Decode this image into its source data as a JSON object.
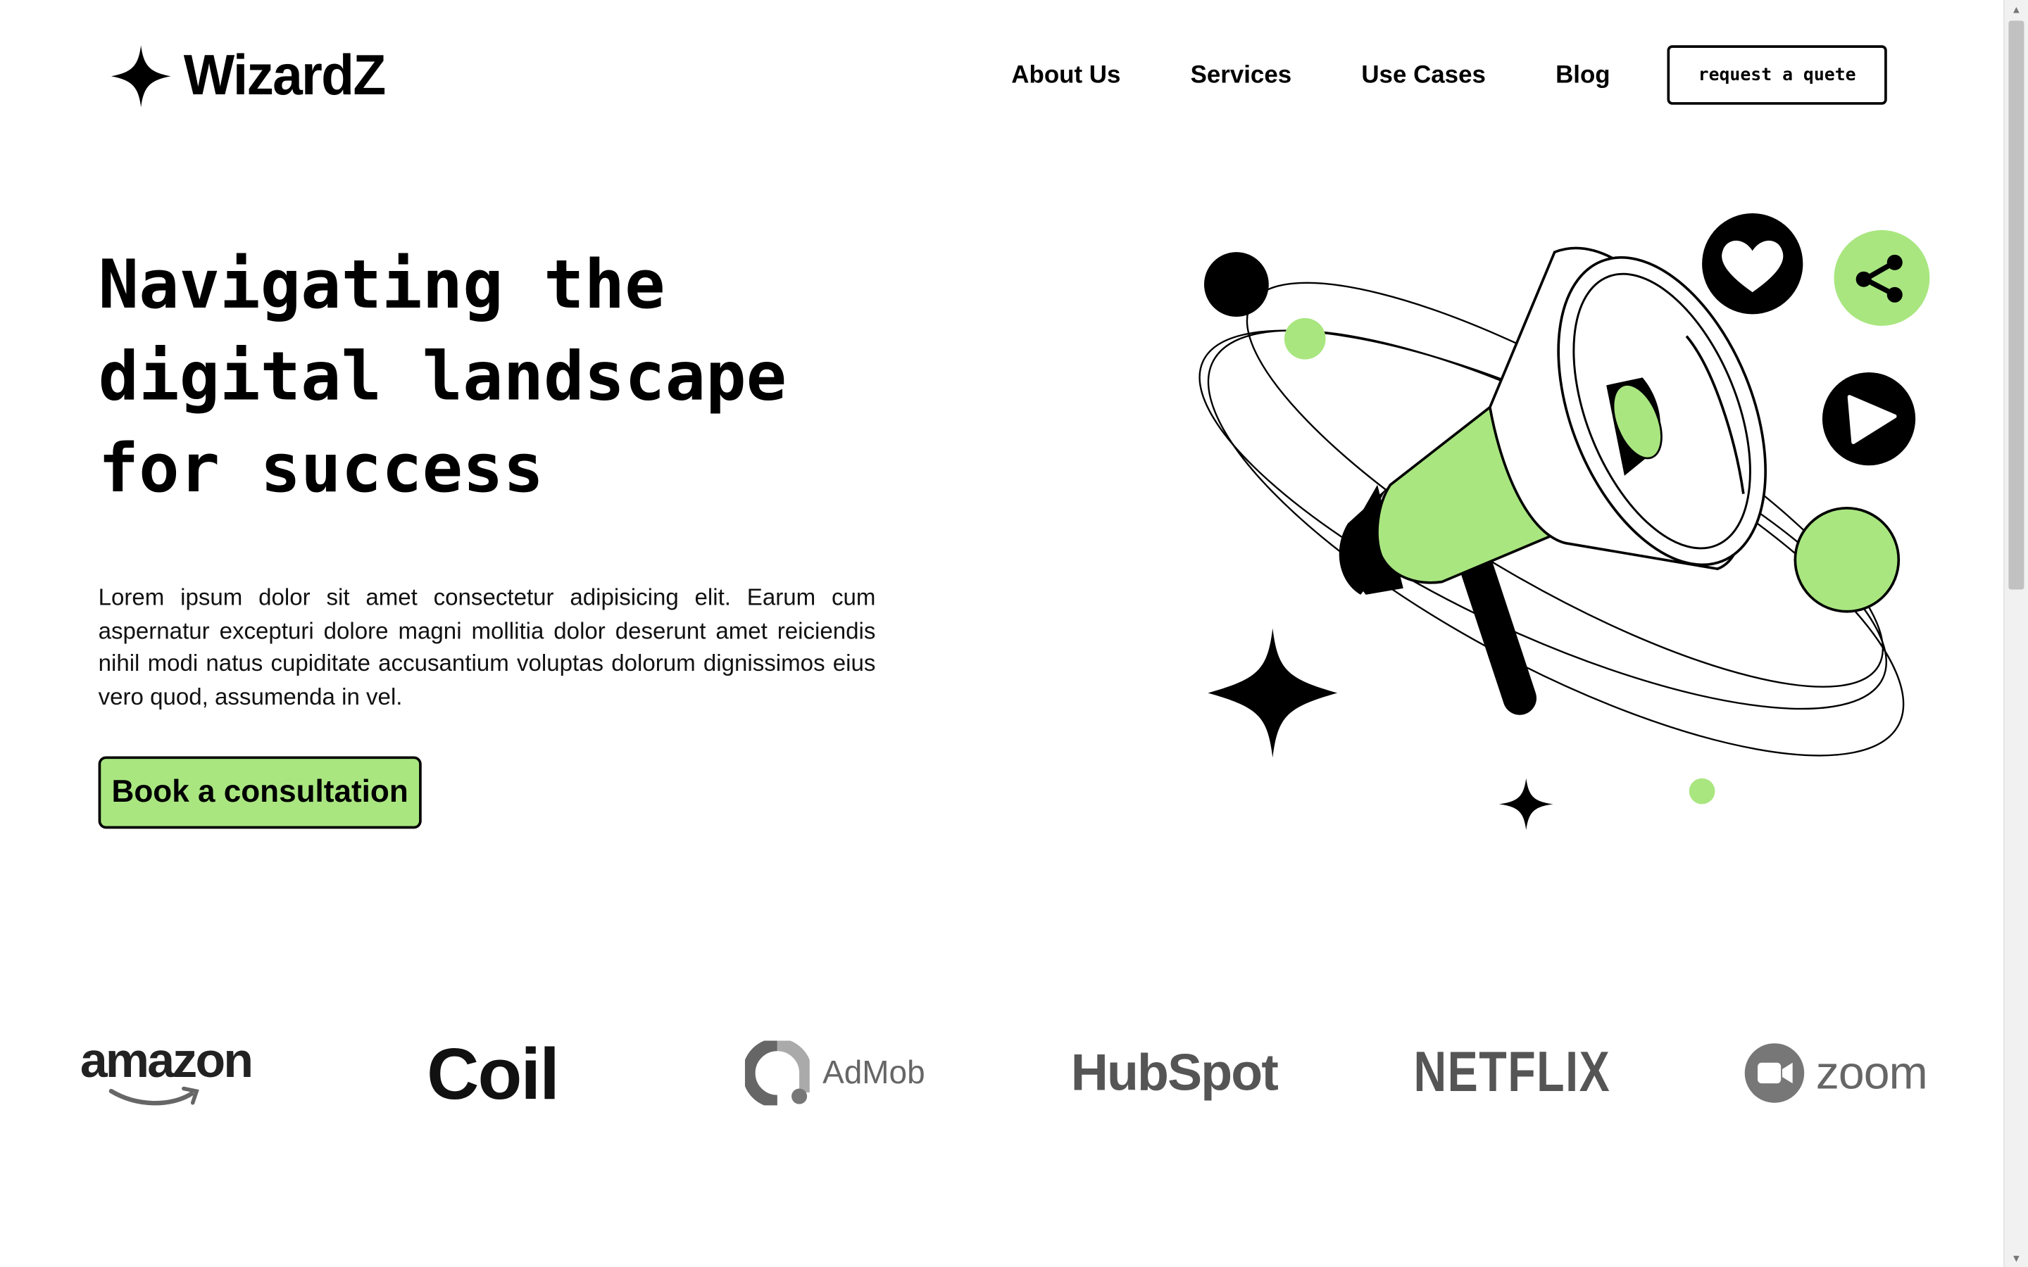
{
  "brand": {
    "name": "WizardZ",
    "logo_icon": "sparkle-star-icon"
  },
  "nav": {
    "items": [
      {
        "label": "About Us"
      },
      {
        "label": "Services"
      },
      {
        "label": "Use Cases"
      },
      {
        "label": "Blog"
      }
    ],
    "quote_button": "request a quete"
  },
  "hero": {
    "title_lines": [
      "Navigating the",
      "digital landscape",
      "for success"
    ],
    "body": "Lorem ipsum dolor sit amet consectetur adipisicing elit. Earum cum aspernatur excepturi dolore magni mollitia dolor deserunt amet reiciendis nihil modi natus cupiditate accusantium voluptas dolorum dignissimos eius vero quod, assumenda in vel.",
    "cta": "Book a consultation",
    "illustration_icons": [
      "megaphone-icon",
      "heart-icon",
      "share-icon",
      "play-icon",
      "sparkle-star-icon"
    ]
  },
  "clients": {
    "logos": [
      {
        "name": "amazon"
      },
      {
        "name": "Coil"
      },
      {
        "name": "AdMob"
      },
      {
        "name": "HubSpot"
      },
      {
        "name": "NETFLIX"
      },
      {
        "name": "zoom"
      }
    ]
  },
  "colors": {
    "accent": "#a9e680",
    "text": "#000000",
    "background": "#ffffff"
  }
}
